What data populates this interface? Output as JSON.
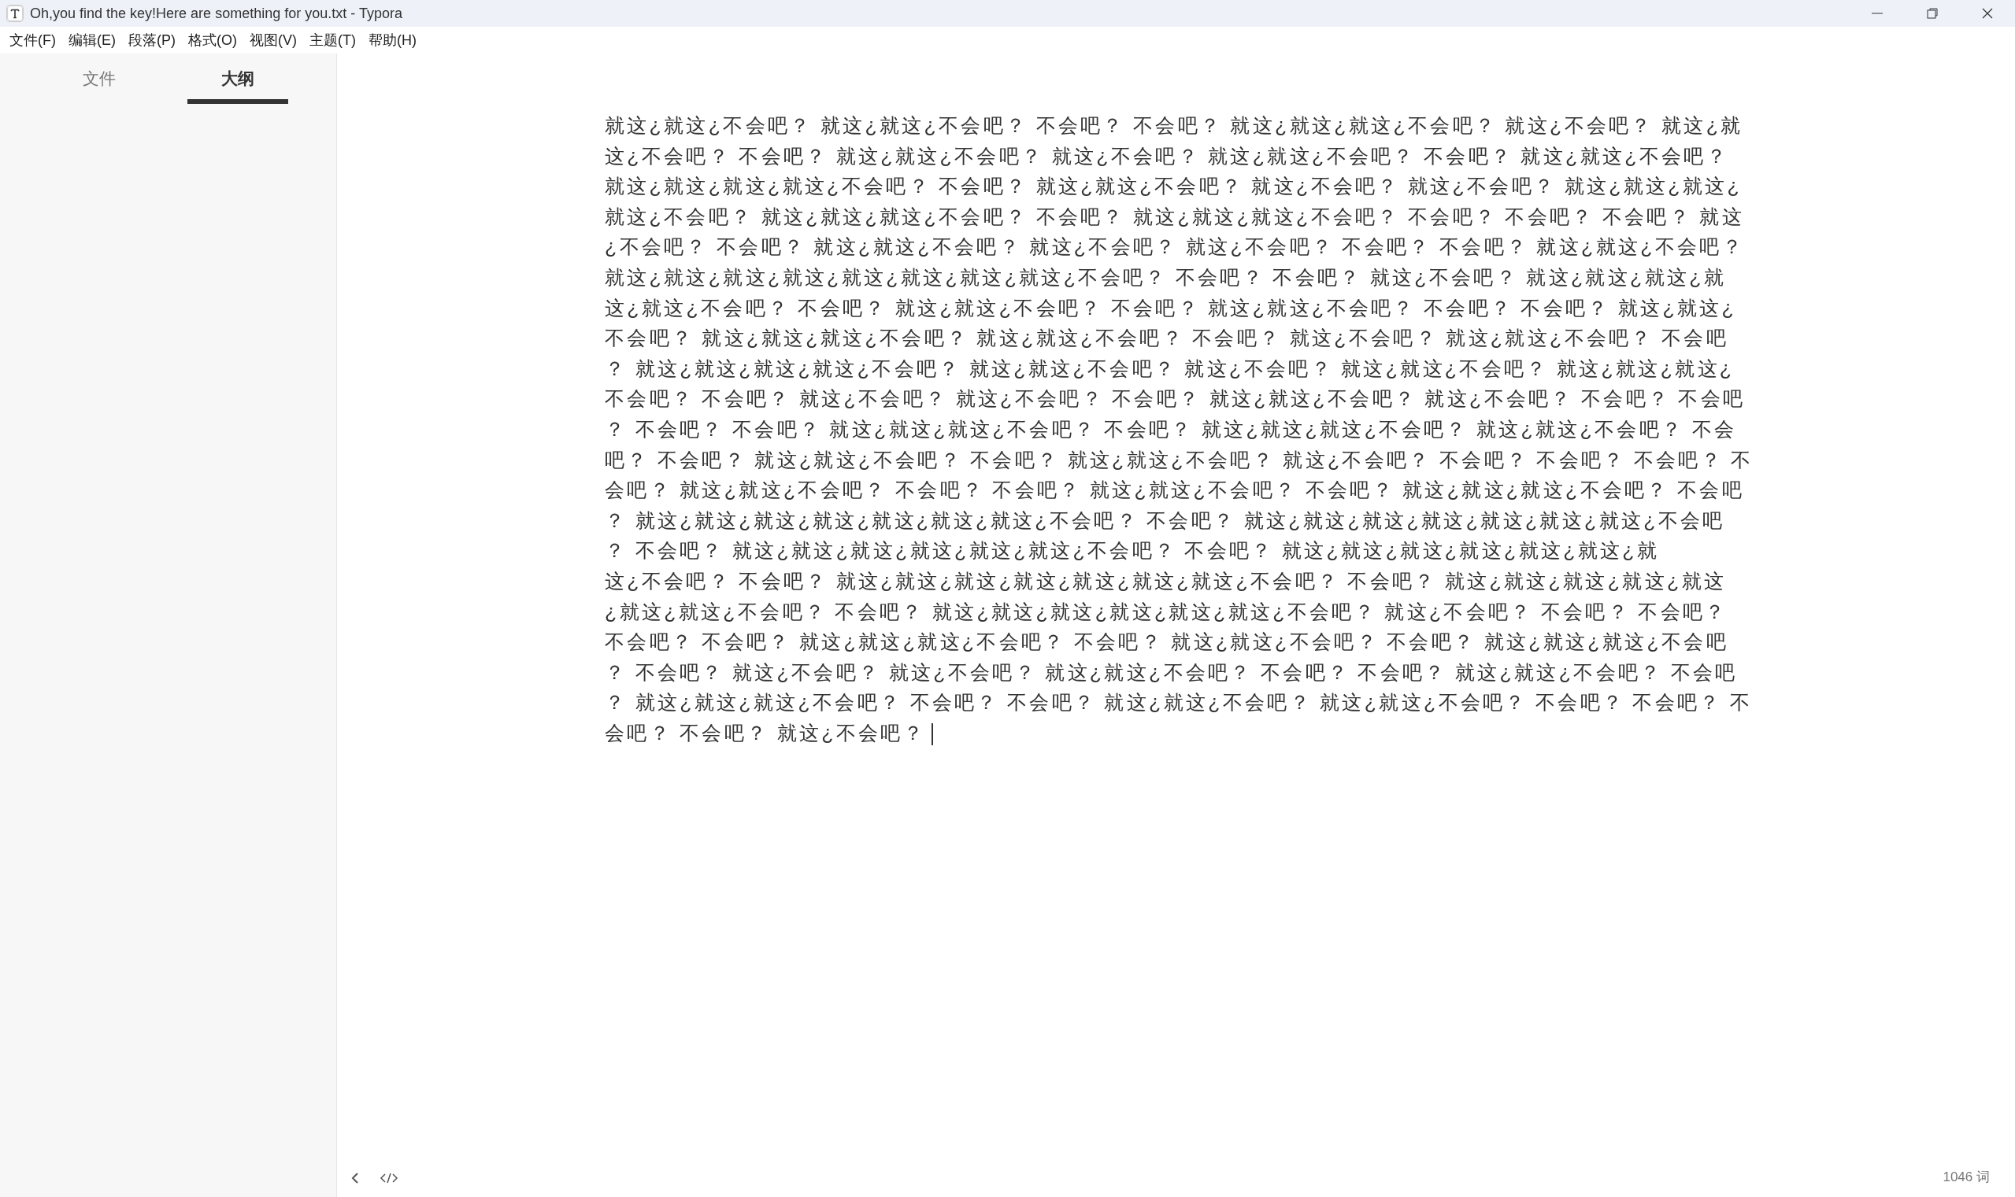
{
  "window": {
    "title": "Oh,you find the key!Here are something for you.txt - Typora"
  },
  "menu": [
    "文件(F)",
    "编辑(E)",
    "段落(P)",
    "格式(O)",
    "视图(V)",
    "主题(T)",
    "帮助(H)"
  ],
  "sidebar": {
    "tabs": [
      {
        "label": "文件",
        "selected": false
      },
      {
        "label": "大纲",
        "selected": true
      }
    ]
  },
  "editor": {
    "lines": [
      "就这¿就这¿不会吧？ 就这¿就这¿不会吧？ 不会吧？ 不会吧？ 就这¿就这¿就这¿不会吧？ 就这¿不会吧？ 就这¿就",
      "这¿不会吧？ 不会吧？ 就这¿就这¿不会吧？ 就这¿不会吧？ 就这¿就这¿不会吧？ 不会吧？ 就这¿就这¿不会吧？",
      "就这¿就这¿就这¿就这¿不会吧？ 不会吧？ 就这¿就这¿不会吧？ 就这¿不会吧？ 就这¿不会吧？ 就这¿就这¿就这¿",
      "就这¿不会吧？ 就这¿就这¿就这¿不会吧？ 不会吧？ 就这¿就这¿就这¿不会吧？ 不会吧？ 不会吧？ 不会吧？ 就这",
      "¿不会吧？ 不会吧？ 就这¿就这¿不会吧？ 就这¿不会吧？ 就这¿不会吧？ 不会吧？ 不会吧？ 就这¿就这¿不会吧？",
      "就这¿就这¿就这¿就这¿就这¿就这¿就这¿就这¿不会吧？ 不会吧？ 不会吧？ 就这¿不会吧？ 就这¿就这¿就这¿就",
      "这¿就这¿不会吧？ 不会吧？ 就这¿就这¿不会吧？ 不会吧？ 就这¿就这¿不会吧？ 不会吧？ 不会吧？ 就这¿就这¿",
      "不会吧？ 就这¿就这¿就这¿不会吧？ 就这¿就这¿不会吧？ 不会吧？ 就这¿不会吧？ 就这¿就这¿不会吧？ 不会吧",
      "？ 就这¿就这¿就这¿就这¿不会吧？ 就这¿就这¿不会吧？ 就这¿不会吧？ 就这¿就这¿不会吧？ 就这¿就这¿就这¿",
      "不会吧？ 不会吧？ 就这¿不会吧？ 就这¿不会吧？ 不会吧？ 就这¿就这¿不会吧？ 就这¿不会吧？ 不会吧？ 不会吧",
      "？ 不会吧？ 不会吧？ 就这¿就这¿就这¿不会吧？ 不会吧？ 就这¿就这¿就这¿不会吧？ 就这¿就这¿不会吧？ 不会",
      "吧？ 不会吧？ 就这¿就这¿不会吧？ 不会吧？ 就这¿就这¿不会吧？ 就这¿不会吧？ 不会吧？ 不会吧？ 不会吧？ 不",
      "会吧？ 就这¿就这¿不会吧？ 不会吧？ 不会吧？ 就这¿就这¿不会吧？ 不会吧？ 就这¿就这¿就这¿不会吧？ 不会吧",
      "？ 就这¿就这¿就这¿就这¿就这¿就这¿就这¿不会吧？ 不会吧？ 就这¿就这¿就这¿就这¿就这¿就这¿就这¿不会吧",
      "？ 不会吧？ 就这¿就这¿就这¿就这¿就这¿就这¿不会吧？ 不会吧？ 就这¿就这¿就这¿就这¿就这¿就这¿就",
      "这¿不会吧？ 不会吧？ 就这¿就这¿就这¿就这¿就这¿就这¿就这¿不会吧？ 不会吧？ 就这¿就这¿就这¿就这¿就这",
      "¿就这¿就这¿不会吧？ 不会吧？ 就这¿就这¿就这¿就这¿就这¿就这¿不会吧？ 就这¿不会吧？ 不会吧？ 不会吧？",
      "不会吧？ 不会吧？ 就这¿就这¿就这¿不会吧？ 不会吧？ 就这¿就这¿不会吧？ 不会吧？ 就这¿就这¿就这¿不会吧",
      "？ 不会吧？ 就这¿不会吧？ 就这¿不会吧？ 就这¿就这¿不会吧？ 不会吧？ 不会吧？ 就这¿就这¿不会吧？ 不会吧",
      "？ 就这¿就这¿就这¿不会吧？ 不会吧？ 不会吧？ 就这¿就这¿不会吧？ 就这¿就这¿不会吧？ 不会吧？ 不会吧？ 不",
      "会吧？ 不会吧？ 就这¿不会吧？"
    ]
  },
  "status_bar": {
    "word_count": "1046 词"
  }
}
